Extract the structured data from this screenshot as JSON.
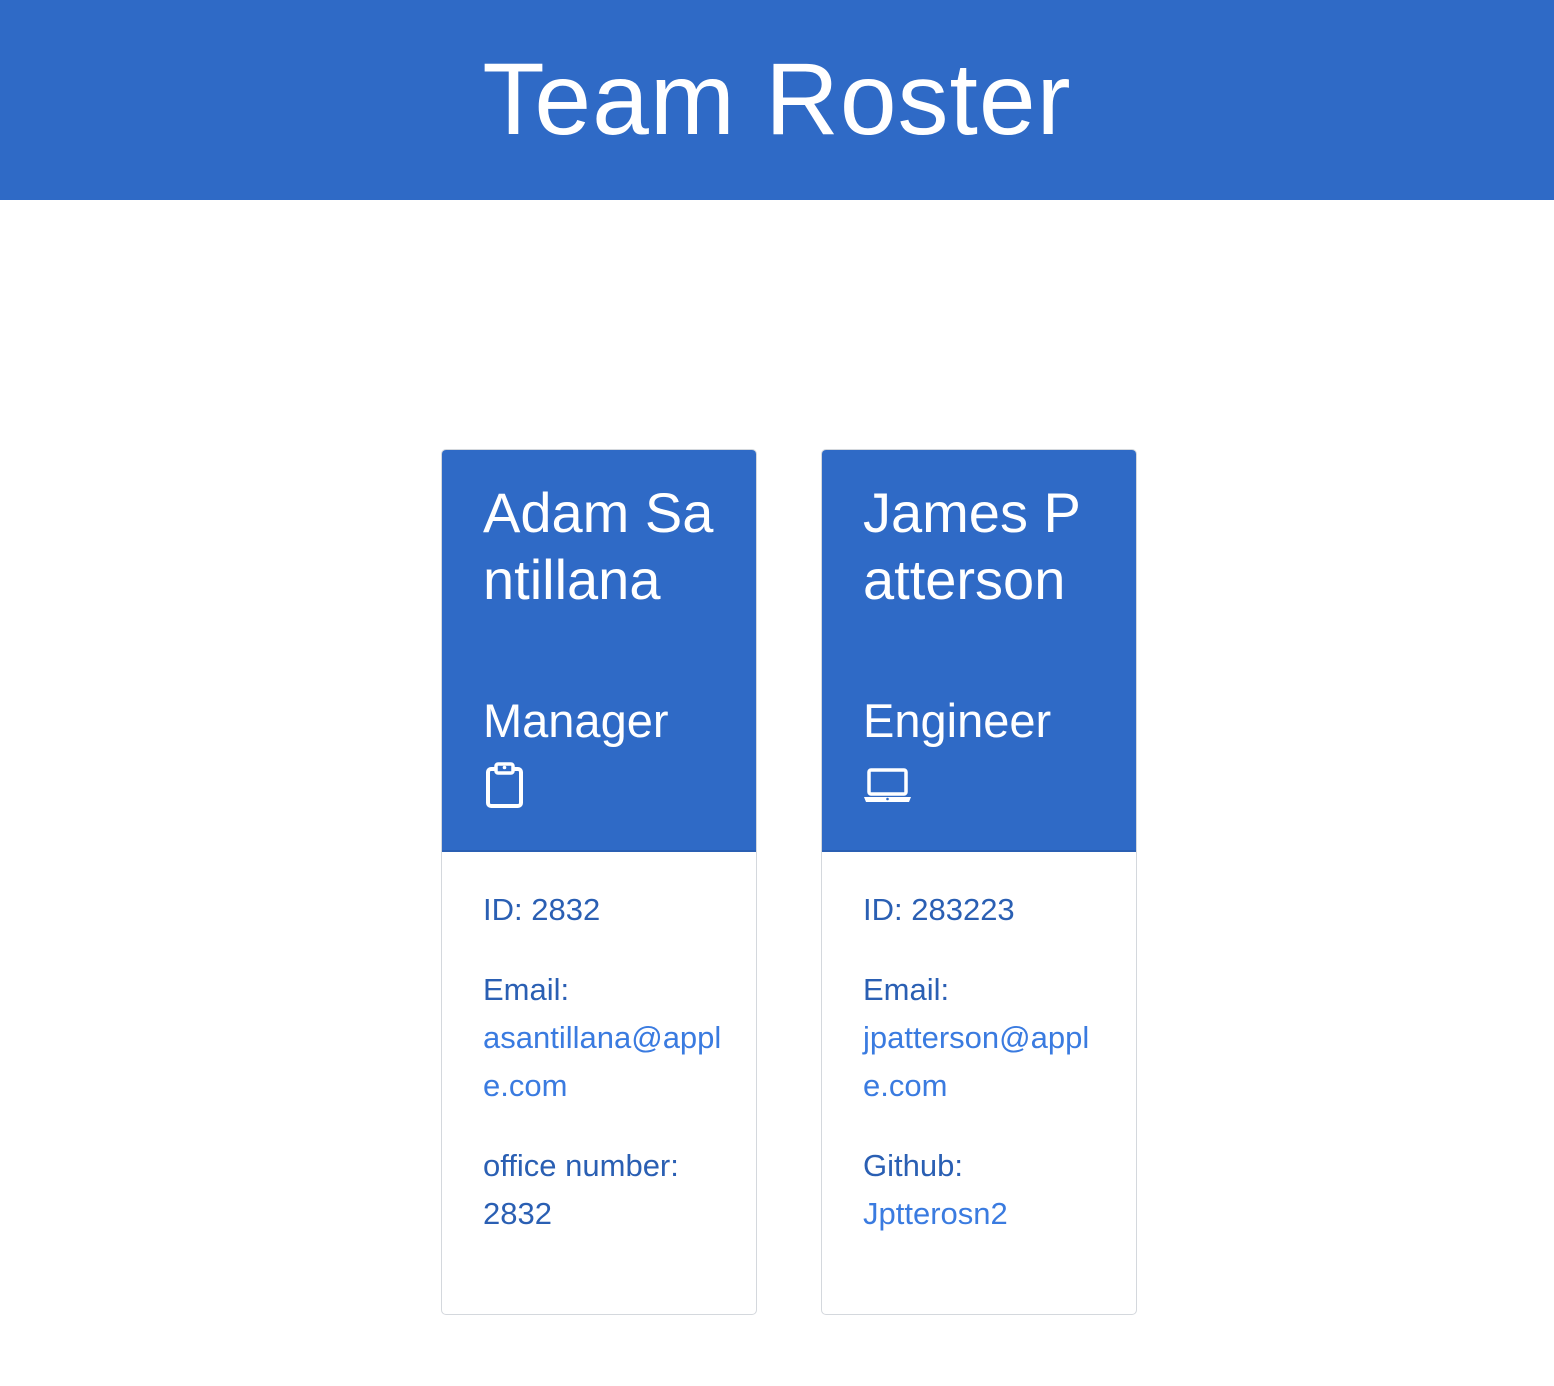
{
  "header": {
    "title": "Team Roster"
  },
  "colors": {
    "primary": "#2f6ac6",
    "text_blue": "#2a5fb3",
    "link_blue": "#3a7be0"
  },
  "employees": [
    {
      "name": "Adam Santillana",
      "role": "Manager",
      "icon": "clipboard-icon",
      "id_label": "ID: 2832",
      "email_label": "Email:",
      "email": "asantillana@apple.com",
      "extra_label": "office number:",
      "extra_value": "2832"
    },
    {
      "name": "James Patterson",
      "role": "Engineer",
      "icon": "laptop-icon",
      "id_label": "ID: 283223",
      "email_label": "Email:",
      "email": "jpatterson@apple.com",
      "extra_label": "Github:",
      "extra_value": "Jptterosn2"
    }
  ]
}
